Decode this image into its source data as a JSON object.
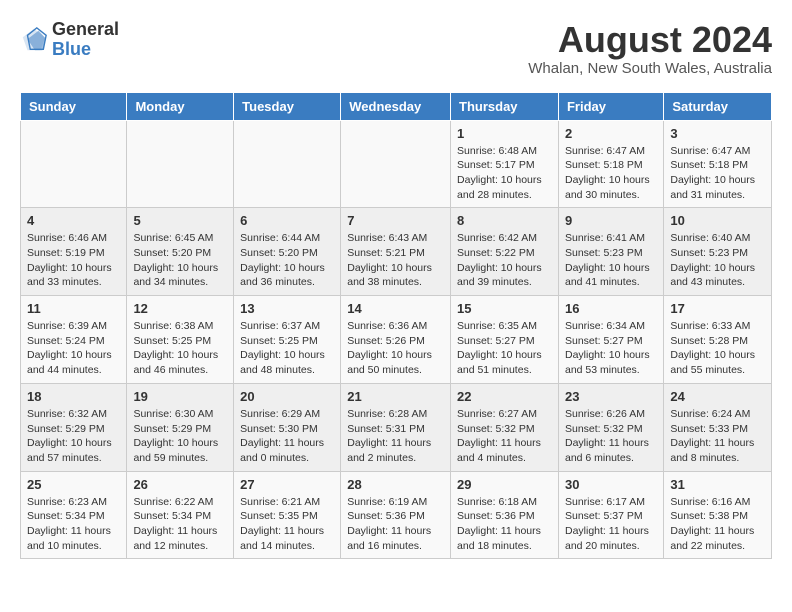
{
  "logo": {
    "general": "General",
    "blue": "Blue"
  },
  "title": "August 2024",
  "location": "Whalan, New South Wales, Australia",
  "weekdays": [
    "Sunday",
    "Monday",
    "Tuesday",
    "Wednesday",
    "Thursday",
    "Friday",
    "Saturday"
  ],
  "rows": [
    [
      {
        "day": "",
        "content": ""
      },
      {
        "day": "",
        "content": ""
      },
      {
        "day": "",
        "content": ""
      },
      {
        "day": "",
        "content": ""
      },
      {
        "day": "1",
        "content": "Sunrise: 6:48 AM\nSunset: 5:17 PM\nDaylight: 10 hours\nand 28 minutes."
      },
      {
        "day": "2",
        "content": "Sunrise: 6:47 AM\nSunset: 5:18 PM\nDaylight: 10 hours\nand 30 minutes."
      },
      {
        "day": "3",
        "content": "Sunrise: 6:47 AM\nSunset: 5:18 PM\nDaylight: 10 hours\nand 31 minutes."
      }
    ],
    [
      {
        "day": "4",
        "content": "Sunrise: 6:46 AM\nSunset: 5:19 PM\nDaylight: 10 hours\nand 33 minutes."
      },
      {
        "day": "5",
        "content": "Sunrise: 6:45 AM\nSunset: 5:20 PM\nDaylight: 10 hours\nand 34 minutes."
      },
      {
        "day": "6",
        "content": "Sunrise: 6:44 AM\nSunset: 5:20 PM\nDaylight: 10 hours\nand 36 minutes."
      },
      {
        "day": "7",
        "content": "Sunrise: 6:43 AM\nSunset: 5:21 PM\nDaylight: 10 hours\nand 38 minutes."
      },
      {
        "day": "8",
        "content": "Sunrise: 6:42 AM\nSunset: 5:22 PM\nDaylight: 10 hours\nand 39 minutes."
      },
      {
        "day": "9",
        "content": "Sunrise: 6:41 AM\nSunset: 5:23 PM\nDaylight: 10 hours\nand 41 minutes."
      },
      {
        "day": "10",
        "content": "Sunrise: 6:40 AM\nSunset: 5:23 PM\nDaylight: 10 hours\nand 43 minutes."
      }
    ],
    [
      {
        "day": "11",
        "content": "Sunrise: 6:39 AM\nSunset: 5:24 PM\nDaylight: 10 hours\nand 44 minutes."
      },
      {
        "day": "12",
        "content": "Sunrise: 6:38 AM\nSunset: 5:25 PM\nDaylight: 10 hours\nand 46 minutes."
      },
      {
        "day": "13",
        "content": "Sunrise: 6:37 AM\nSunset: 5:25 PM\nDaylight: 10 hours\nand 48 minutes."
      },
      {
        "day": "14",
        "content": "Sunrise: 6:36 AM\nSunset: 5:26 PM\nDaylight: 10 hours\nand 50 minutes."
      },
      {
        "day": "15",
        "content": "Sunrise: 6:35 AM\nSunset: 5:27 PM\nDaylight: 10 hours\nand 51 minutes."
      },
      {
        "day": "16",
        "content": "Sunrise: 6:34 AM\nSunset: 5:27 PM\nDaylight: 10 hours\nand 53 minutes."
      },
      {
        "day": "17",
        "content": "Sunrise: 6:33 AM\nSunset: 5:28 PM\nDaylight: 10 hours\nand 55 minutes."
      }
    ],
    [
      {
        "day": "18",
        "content": "Sunrise: 6:32 AM\nSunset: 5:29 PM\nDaylight: 10 hours\nand 57 minutes."
      },
      {
        "day": "19",
        "content": "Sunrise: 6:30 AM\nSunset: 5:29 PM\nDaylight: 10 hours\nand 59 minutes."
      },
      {
        "day": "20",
        "content": "Sunrise: 6:29 AM\nSunset: 5:30 PM\nDaylight: 11 hours\nand 0 minutes."
      },
      {
        "day": "21",
        "content": "Sunrise: 6:28 AM\nSunset: 5:31 PM\nDaylight: 11 hours\nand 2 minutes."
      },
      {
        "day": "22",
        "content": "Sunrise: 6:27 AM\nSunset: 5:32 PM\nDaylight: 11 hours\nand 4 minutes."
      },
      {
        "day": "23",
        "content": "Sunrise: 6:26 AM\nSunset: 5:32 PM\nDaylight: 11 hours\nand 6 minutes."
      },
      {
        "day": "24",
        "content": "Sunrise: 6:24 AM\nSunset: 5:33 PM\nDaylight: 11 hours\nand 8 minutes."
      }
    ],
    [
      {
        "day": "25",
        "content": "Sunrise: 6:23 AM\nSunset: 5:34 PM\nDaylight: 11 hours\nand 10 minutes."
      },
      {
        "day": "26",
        "content": "Sunrise: 6:22 AM\nSunset: 5:34 PM\nDaylight: 11 hours\nand 12 minutes."
      },
      {
        "day": "27",
        "content": "Sunrise: 6:21 AM\nSunset: 5:35 PM\nDaylight: 11 hours\nand 14 minutes."
      },
      {
        "day": "28",
        "content": "Sunrise: 6:19 AM\nSunset: 5:36 PM\nDaylight: 11 hours\nand 16 minutes."
      },
      {
        "day": "29",
        "content": "Sunrise: 6:18 AM\nSunset: 5:36 PM\nDaylight: 11 hours\nand 18 minutes."
      },
      {
        "day": "30",
        "content": "Sunrise: 6:17 AM\nSunset: 5:37 PM\nDaylight: 11 hours\nand 20 minutes."
      },
      {
        "day": "31",
        "content": "Sunrise: 6:16 AM\nSunset: 5:38 PM\nDaylight: 11 hours\nand 22 minutes."
      }
    ]
  ]
}
